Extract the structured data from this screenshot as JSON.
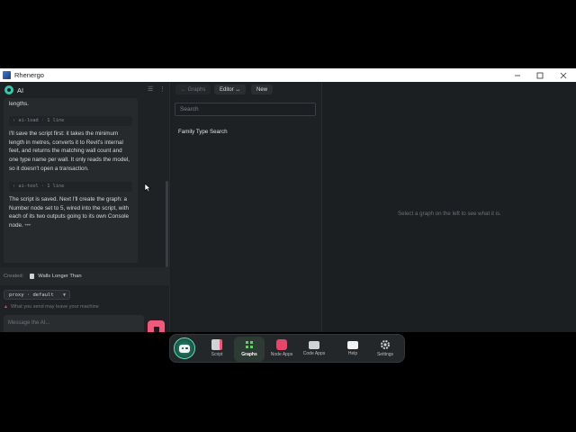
{
  "window": {
    "title": "Rhenergo"
  },
  "ai_panel": {
    "title": "AI",
    "messages": [
      "lengths.",
      "I'll save the script first: it takes the minimum length in metres, converts it to Revit's internal feet, and returns the matching wall count and one type name per wall. It only reads the model, so it doesn't open a transaction.",
      "The script is saved. Next I'll create the graph: a Number node set to 5, wired into the script, with each of its two outputs going to its own Console node."
    ],
    "tool_calls": [
      {
        "name": "› ai-load · 1 line"
      },
      {
        "name": "› ai-tool · 1 line"
      }
    ],
    "typing_indicator": "•••",
    "created_label": "Created:",
    "created_value": "Walls Longer Than",
    "proxy_value": "proxy · default",
    "warning_text": "What you send may leave your machine",
    "message_placeholder": "Message the AI..."
  },
  "graphs_toolbar": {
    "graphs_label": "← Graphs",
    "editor_label": "Editor ↔",
    "new_label": "New"
  },
  "search": {
    "placeholder": "Search"
  },
  "graph_list": [
    "Family Type Search"
  ],
  "detail": {
    "placeholder": "Select a graph on the left to see what it is."
  },
  "dock": {
    "items": [
      {
        "label": "Script",
        "icon": "script-icon",
        "color": "#e55a7a"
      },
      {
        "label": "Graphs",
        "icon": "graphs-icon",
        "color": "#5fd35f",
        "active": true
      },
      {
        "label": "Node Apps",
        "icon": "node-apps-icon",
        "color": "#e5466a"
      },
      {
        "label": "Code Apps",
        "icon": "code-apps-icon",
        "color": "#cfd3d6"
      },
      {
        "label": "Help",
        "icon": "help-icon",
        "color": "#ffffff"
      },
      {
        "label": "Settings",
        "icon": "settings-icon",
        "color": "#cfd3d6"
      }
    ]
  },
  "colors": {
    "accent": "#3cc8a8",
    "stop": "#ec5a7c",
    "bg": "#1c1f21"
  }
}
